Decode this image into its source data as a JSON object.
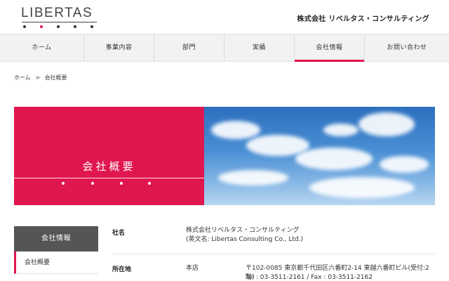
{
  "header": {
    "logo": "LIBERTAS",
    "company": "株式会社 リベルタス・コンサルティング",
    "logo_dot_colors": [
      "#333333",
      "#e0164f",
      "#333333",
      "#333333",
      "#333333"
    ]
  },
  "nav": {
    "items": [
      "ホーム",
      "事業内容",
      "部門",
      "実績",
      "会社情報",
      "お問い合わせ"
    ],
    "active": "会社情報"
  },
  "breadcrumb": {
    "home": "ホーム",
    "sep": ">",
    "current": "会社概要"
  },
  "hero": {
    "title": "会社概要"
  },
  "sidebar": {
    "heading": "会社情報",
    "items": [
      "会社概要"
    ]
  },
  "table": {
    "rows": [
      {
        "label": "社名",
        "line1": "株式会社リベルタス・コンサルティング",
        "line2": "(英文名: Libertas Consulting Co., Ltd.)"
      },
      {
        "label": "所在地",
        "sub": "本店",
        "line1": "〒102-0085 東京都千代田区六番町2-14 東越六番町ビル(受付:2階)",
        "line2": "Tel : 03-3511-2161 / Fax : 03-3511-2162"
      }
    ]
  },
  "colors": {
    "accent": "#e0164f",
    "nav_bg": "#f2f2f2",
    "sidebar_head": "#555555"
  }
}
